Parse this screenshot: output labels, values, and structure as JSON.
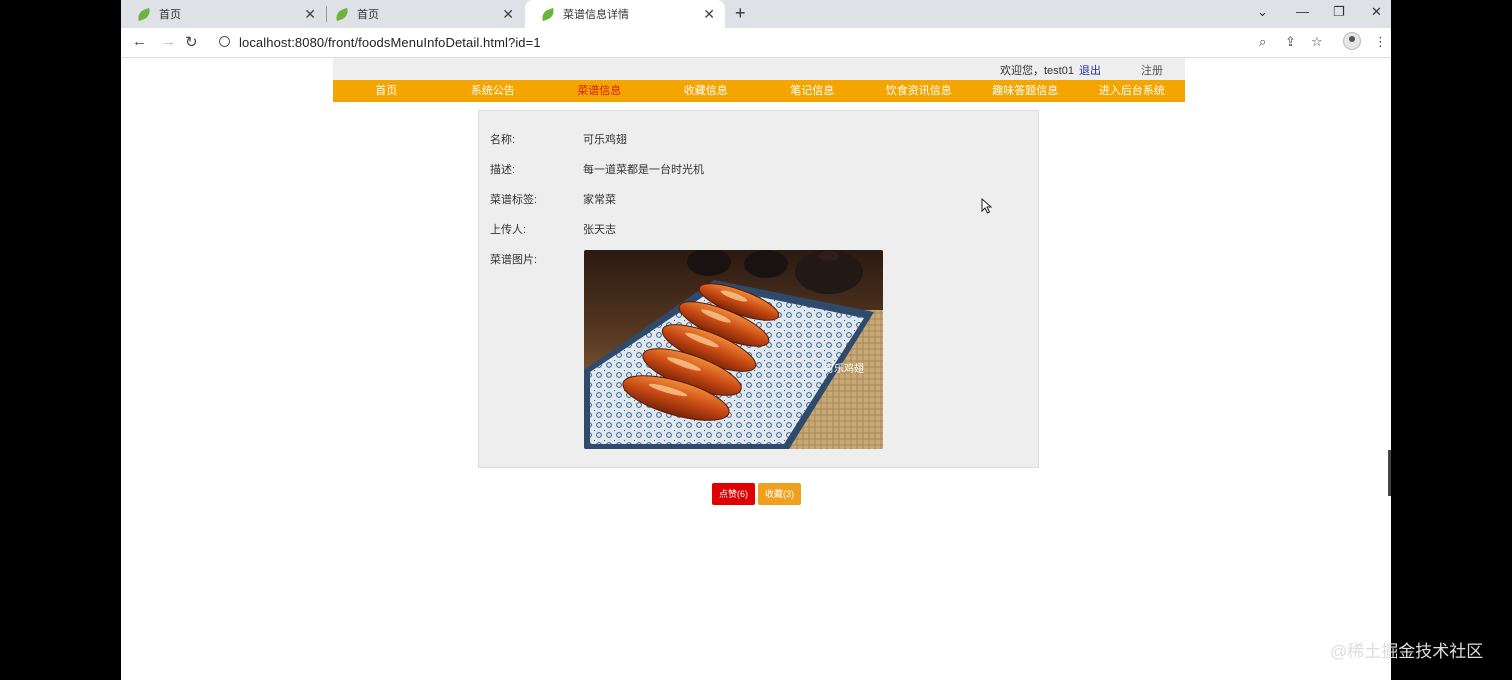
{
  "browser": {
    "tabs": [
      {
        "title": "首页"
      },
      {
        "title": "首页"
      },
      {
        "title": "菜谱信息详情"
      }
    ],
    "url": "localhost:8080/front/foodsMenuInfoDetail.html?id=1"
  },
  "header": {
    "welcome": "欢迎您，test01",
    "logout": "退出",
    "register": "注册"
  },
  "nav": [
    {
      "label": "首页"
    },
    {
      "label": "系统公告"
    },
    {
      "label": "菜谱信息"
    },
    {
      "label": "收藏信息"
    },
    {
      "label": "笔记信息"
    },
    {
      "label": "饮食资讯信息"
    },
    {
      "label": "趣味答题信息"
    },
    {
      "label": "进入后台系统"
    }
  ],
  "active_nav": "菜谱信息",
  "detail": {
    "fields": [
      {
        "label": "名称:",
        "value": "可乐鸡翅"
      },
      {
        "label": "描述:",
        "value": "每一道菜都是一台时光机"
      },
      {
        "label": "菜谱标签:",
        "value": "家常菜"
      },
      {
        "label": "上传人:",
        "value": "张天志"
      }
    ],
    "image_label": "菜谱图片:",
    "image_caption": "可乐鸡翅"
  },
  "actions": {
    "like": "点赞(6)",
    "favorite": "收藏(3)"
  },
  "watermark": "@稀土掘金技术社区",
  "colors": {
    "nav_bg": "#f5a500",
    "nav_active": "#d81e06",
    "like_btn": "#e00000",
    "fav_btn": "#f0a020"
  }
}
